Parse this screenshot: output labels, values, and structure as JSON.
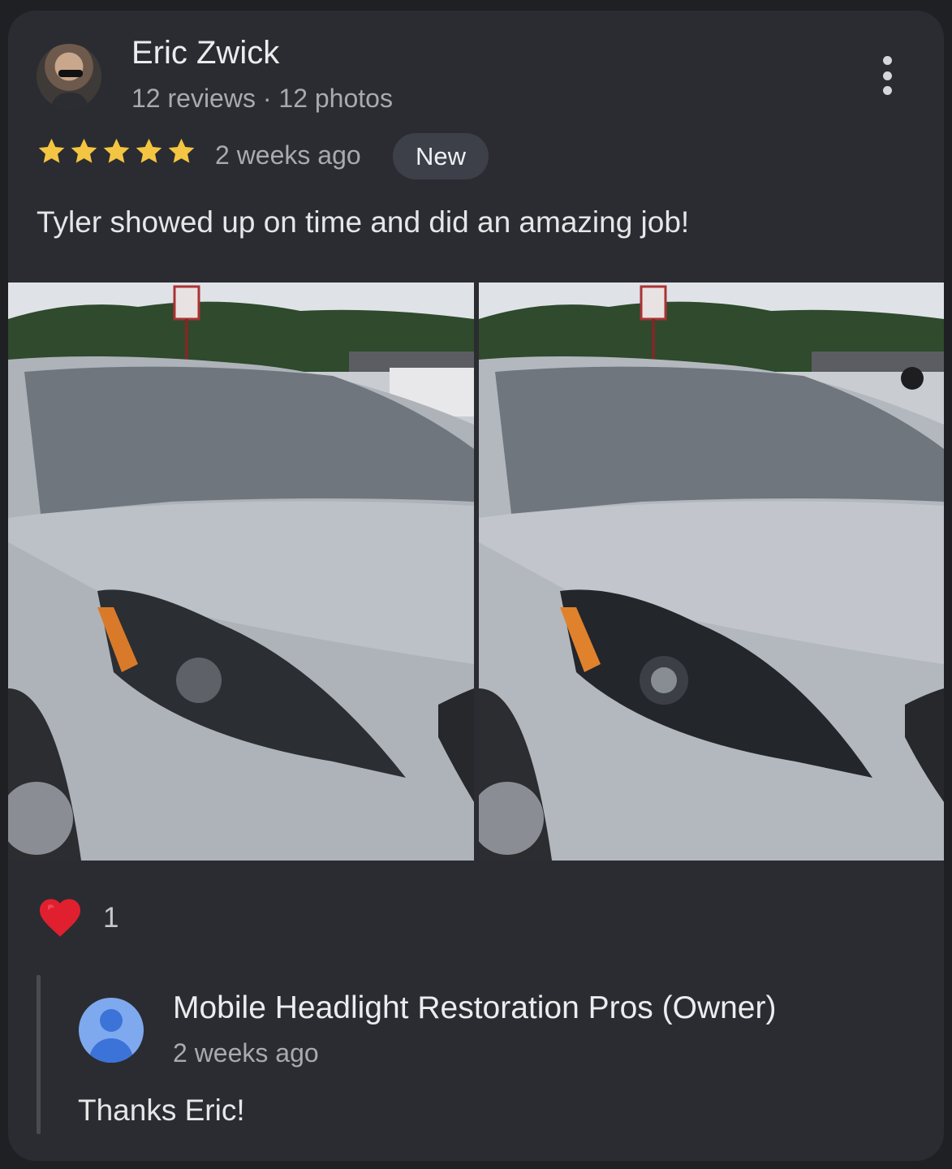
{
  "review": {
    "author_name": "Eric Zwick",
    "author_meta": "12 reviews · 12 photos",
    "rating": 5,
    "time": "2 weeks ago",
    "badge": "New",
    "text": "Tyler showed up on time and did an amazing job!"
  },
  "reactions": {
    "heart_icon": "heart-icon",
    "count": "1"
  },
  "owner_reply": {
    "name": "Mobile Headlight Restoration Pros (Owner)",
    "time": "2 weeks ago",
    "text": "Thanks Eric!"
  },
  "colors": {
    "star": "#f4c542",
    "badge_bg": "#3d4049",
    "heart": "#e0202e",
    "owner_avatar": "#7fa9ee"
  }
}
